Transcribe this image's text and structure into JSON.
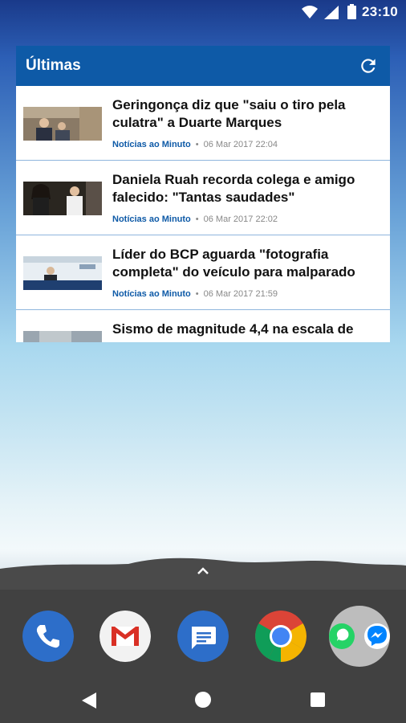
{
  "status_bar": {
    "time": "23:10",
    "icons": [
      "wifi-icon",
      "signal-icon",
      "battery-icon"
    ]
  },
  "widget": {
    "title": "Últimas",
    "refresh_icon": "refresh-icon",
    "items": [
      {
        "headline": "Geringonça diz que \"saiu o tiro pela culatra\" a Duarte Marques",
        "source": "Notícias ao Minuto",
        "date": "06 Mar 2017 22:04"
      },
      {
        "headline": "Daniela Ruah recorda colega e amigo falecido: \"Tantas saudades\"",
        "source": "Notícias ao Minuto",
        "date": "06 Mar 2017 22:02"
      },
      {
        "headline": "Líder do BCP aguarda \"fotografia completa\" do veículo para malparado",
        "source": "Notícias ao Minuto",
        "date": "06 Mar 2017 21:59"
      },
      {
        "headline": "Sismo de magnitude 4,4 na escala de",
        "source": "",
        "date": ""
      }
    ]
  },
  "dock": {
    "apps": [
      "phone-icon",
      "gmail-icon",
      "messages-icon",
      "chrome-icon",
      "whatsapp-messenger-folder-icon"
    ]
  },
  "nav": {
    "buttons": [
      "back-button",
      "home-button",
      "recents-button"
    ]
  }
}
